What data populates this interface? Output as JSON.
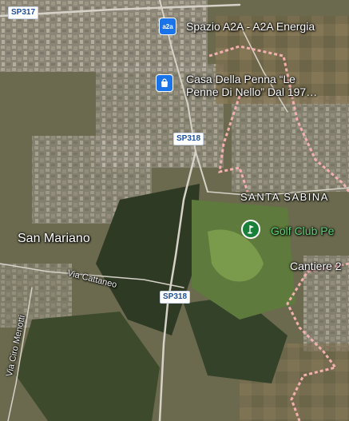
{
  "map": {
    "roads": {
      "sp317": "SP317",
      "sp318_top": "SP318",
      "sp318_bottom": "SP318",
      "via_cattaneo": "Via Cattaneo",
      "via_ciro_menotti": "Via Ciro Menotti"
    },
    "places": {
      "san_mariano": "San Mariano",
      "santa_sabina": "SANTA SABINA",
      "cantiere": "Cantiere 2"
    },
    "pois": [
      {
        "name": "Spazio A2A - A2A Energia",
        "icon": "a2a-logo-icon",
        "badge_text": "a2a"
      },
      {
        "name_line1": "Casa Della Penna “Le",
        "name_line2": "Penne Di Nello” Dal 197…",
        "icon": "shopping-bag-icon"
      },
      {
        "name": "Golf Club Pe",
        "icon": "golf-icon"
      }
    ],
    "colors": {
      "boundary": "#e98a8a",
      "poi_blue": "#1a73e8",
      "poi_green": "#188038",
      "golf_text": "#5fd07a"
    }
  }
}
